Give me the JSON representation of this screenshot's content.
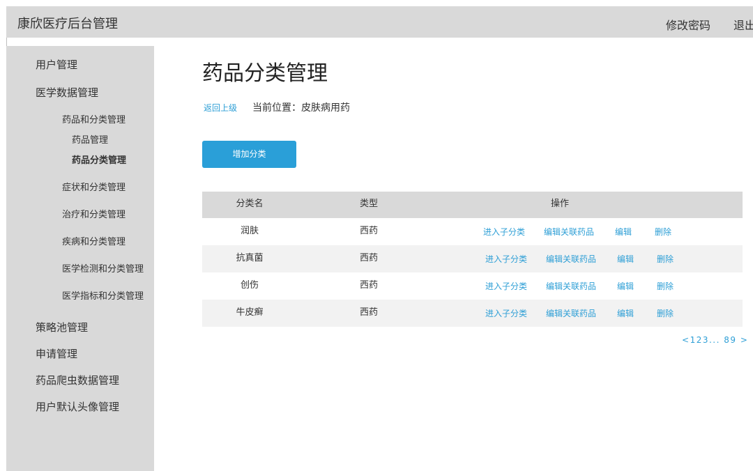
{
  "header": {
    "app_title": "康欣医疗后台管理",
    "change_password": "修改密码",
    "logout": "退出"
  },
  "sidebar": {
    "user_mgmt": "用户管理",
    "medical_data_mgmt": "医学数据管理",
    "drug_and_category": "药品和分类管理",
    "drug_mgmt": "药品管理",
    "drug_category_mgmt": "药品分类管理",
    "symptom_and_category": "症状和分类管理",
    "treatment_and_category": "治疗和分类管理",
    "disease_and_category": "疾病和分类管理",
    "exam_and_category": "医学检测和分类管理",
    "indicator_and_category": "医学指标和分类管理",
    "strategy_pool": "策略池管理",
    "application_mgmt": "申请管理",
    "crawler_data": "药品爬虫数据管理",
    "default_avatar": "用户默认头像管理"
  },
  "main": {
    "title": "药品分类管理",
    "back": "返回上级",
    "location_label": "当前位置：",
    "location_value": "皮肤病用药",
    "add_button": "增加分类"
  },
  "table": {
    "headers": {
      "name": "分类名",
      "type": "类型",
      "ops": "操作"
    },
    "actions": {
      "enter": "进入子分类",
      "edit_related": "编辑关联药品",
      "edit": "编辑",
      "delete": "删除"
    },
    "rows": [
      {
        "name": "润肤",
        "type": "西药"
      },
      {
        "name": "抗真菌",
        "type": "西药"
      },
      {
        "name": "创伤",
        "type": "西药"
      },
      {
        "name": "牛皮癣",
        "type": "西药"
      }
    ]
  },
  "pager": {
    "prev": "<",
    "pages": "123...",
    "last": "89",
    "next": ">"
  }
}
